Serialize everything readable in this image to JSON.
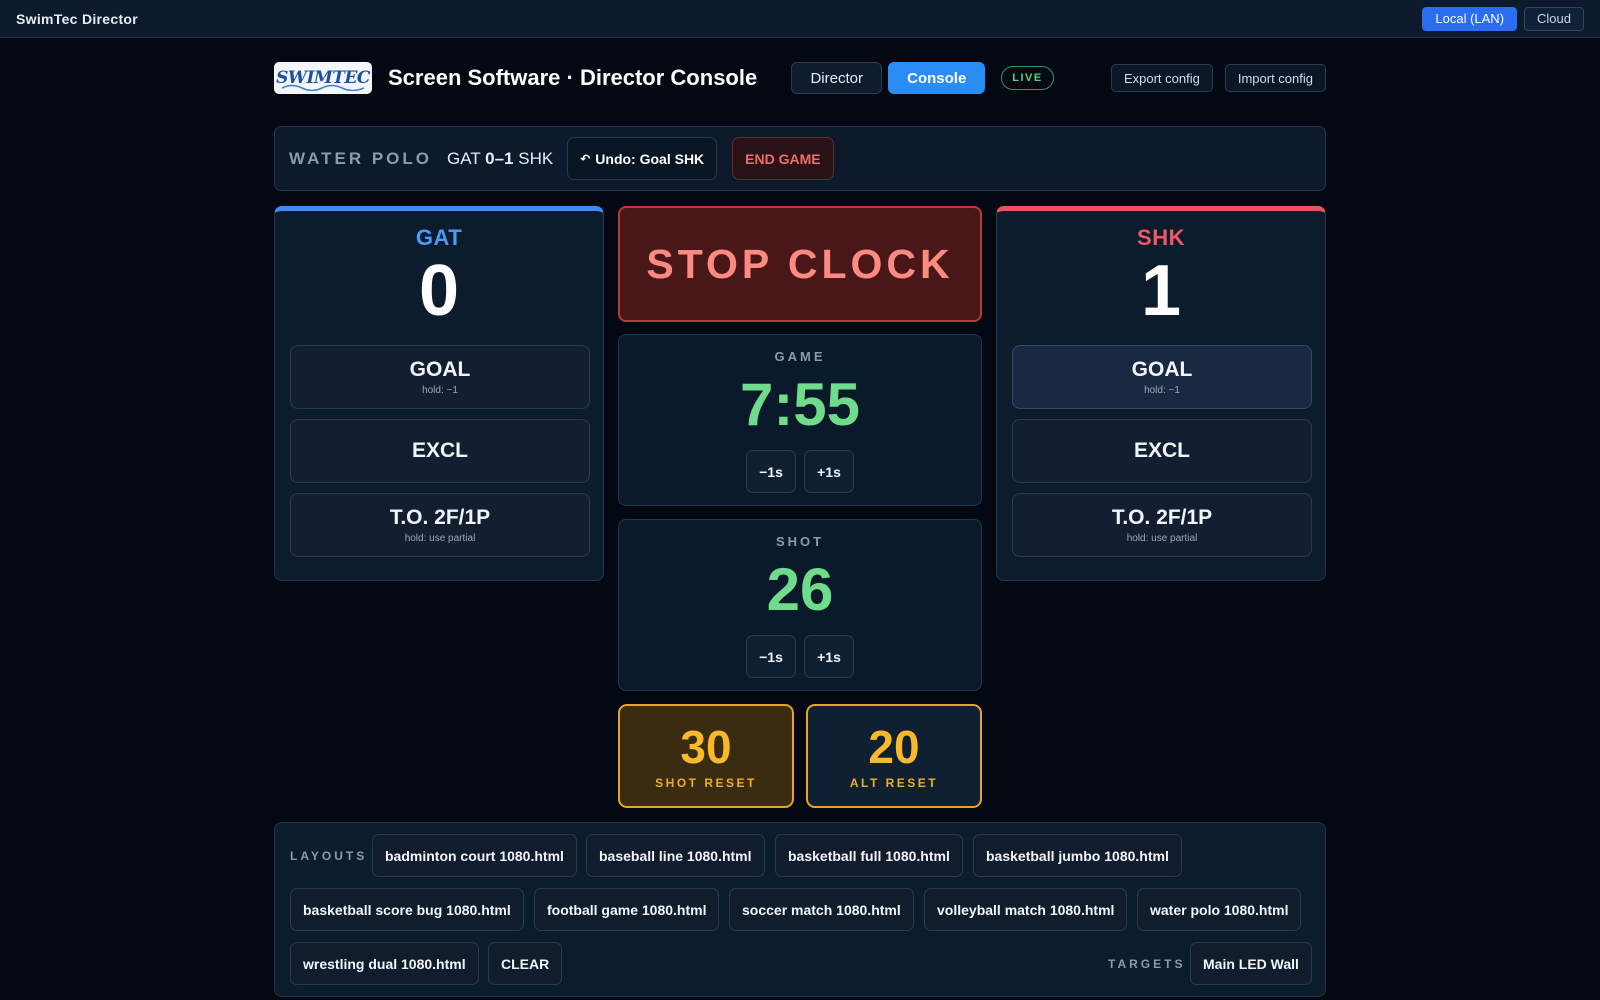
{
  "app": {
    "title": "SwimTec Director",
    "connections": [
      {
        "label": "Local (LAN)",
        "active": true
      },
      {
        "label": "Cloud",
        "active": false
      }
    ]
  },
  "header": {
    "logo_text": "SWIMTEC",
    "title": "Screen Software · Director Console",
    "tabs": [
      {
        "label": "Director",
        "active": false
      },
      {
        "label": "Console",
        "active": true
      }
    ],
    "live_badge": "LIVE",
    "export_label": "Export config",
    "import_label": "Import config"
  },
  "sportbar": {
    "sport": "WATER POLO",
    "home_abbr": "GAT",
    "score": "0–1",
    "away_abbr": "SHK",
    "undo_icon": "↶",
    "undo_label": "Undo: Goal SHK",
    "end_label": "END GAME"
  },
  "home": {
    "name": "GAT",
    "score": "0",
    "color": "#3b8df2",
    "goal_label": "GOAL",
    "goal_hint": "hold: −1",
    "excl_label": "EXCL",
    "timeout_label": "T.O. 2F/1P",
    "timeout_hint": "hold: use partial"
  },
  "away": {
    "name": "SHK",
    "score": "1",
    "color": "#ef5161",
    "goal_label": "GOAL",
    "goal_hint": "hold: −1",
    "excl_label": "EXCL",
    "timeout_label": "T.O. 2F/1P",
    "timeout_hint": "hold: use partial"
  },
  "center": {
    "stop_label": "STOP CLOCK",
    "game_clock": {
      "title": "GAME",
      "value": "7:55",
      "minus": "−1s",
      "plus": "+1s"
    },
    "shot_clock": {
      "title": "SHOT",
      "value": "26",
      "minus": "−1s",
      "plus": "+1s"
    },
    "shot_reset": {
      "value": "30",
      "label": "SHOT RESET"
    },
    "alt_reset": {
      "value": "20",
      "label": "ALT RESET"
    }
  },
  "layouts": {
    "label": "LAYOUTS",
    "items": [
      "badminton court 1080.html",
      "baseball line 1080.html",
      "basketball full 1080.html",
      "basketball jumbo 1080.html",
      "basketball score bug 1080.html",
      "football game 1080.html",
      "soccer match 1080.html",
      "volleyball match 1080.html",
      "water polo 1080.html",
      "wrestling dual 1080.html"
    ],
    "clear_label": "CLEAR",
    "targets_label": "TARGETS",
    "target": "Main LED Wall"
  }
}
